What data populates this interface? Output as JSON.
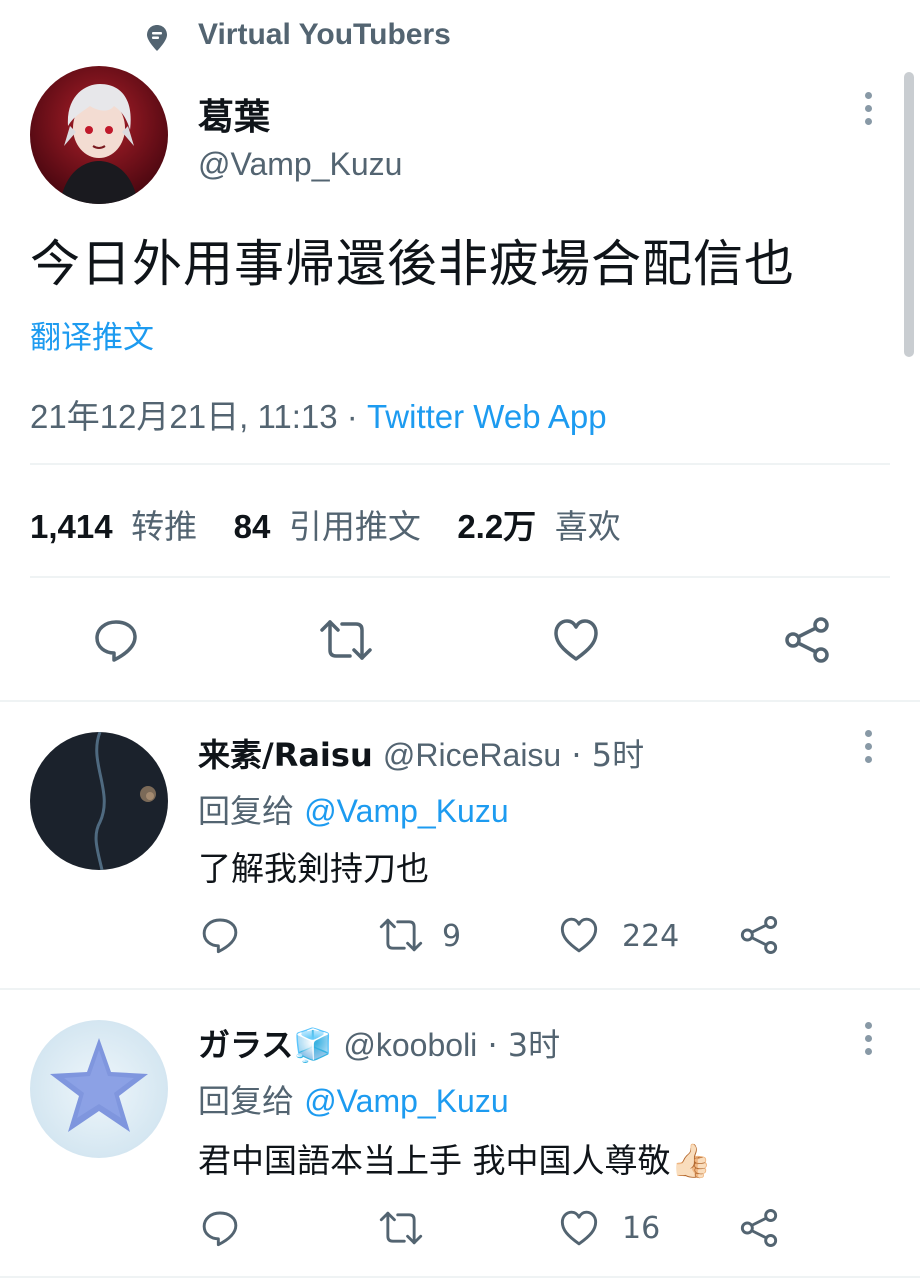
{
  "context": {
    "label": "Virtual YouTubers",
    "icon": "topic-pin-icon"
  },
  "main_tweet": {
    "display_name": "葛葉",
    "handle": "@Vamp_Kuzu",
    "avatar": "avatar-vamp-kuzu",
    "text": "今日外用事帰還後非疲場合配信也",
    "translate_label": "翻译推文",
    "timestamp": "21年12月21日, 11:13",
    "separator": "·",
    "source": "Twitter Web App",
    "stats": [
      {
        "value": "1,414",
        "label": "转推"
      },
      {
        "value": "84",
        "label": "引用推文"
      },
      {
        "value": "2.2万",
        "label": "喜欢"
      }
    ],
    "actions": [
      "reply-icon",
      "retweet-icon",
      "like-icon",
      "share-icon"
    ]
  },
  "replies": [
    {
      "display_name": "来素/Raisu",
      "handle": "@RiceRaisu",
      "time": "· 5时",
      "reply_to_label": "回复给",
      "reply_to_handle": "@Vamp_Kuzu",
      "text": "了解我剣持刀也",
      "retweets": "9",
      "likes": "224"
    },
    {
      "display_name": "ガラス",
      "name_emoji": "🧊",
      "handle": "@kooboli",
      "time": "· 3时",
      "reply_to_label": "回复给",
      "reply_to_handle": "@Vamp_Kuzu",
      "text": "君中国語本当上手 我中国人尊敬",
      "text_emoji": "👍🏻",
      "retweets": "",
      "likes": "16"
    }
  ],
  "colors": {
    "link": "#1d9bf0",
    "muted": "#536471",
    "text": "#0f1419",
    "divider": "#eff3f4"
  }
}
